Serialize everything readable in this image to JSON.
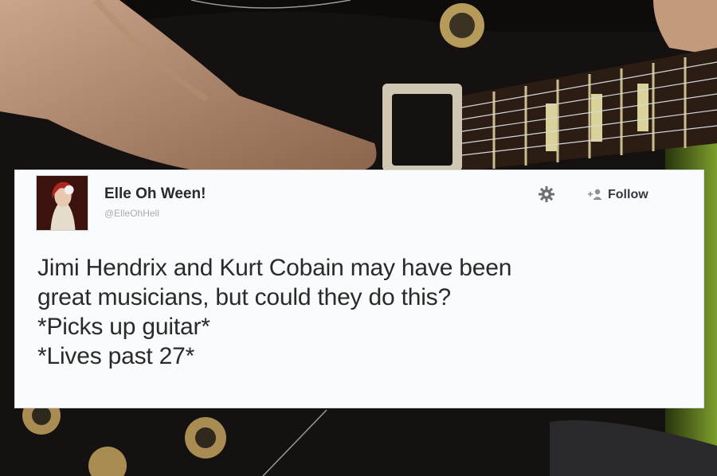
{
  "tweet": {
    "display_name": "Elle Oh Ween!",
    "handle": "@ElleOhHell",
    "follow_label": "Follow",
    "lines": [
      "Jimi Hendrix and Kurt Cobain may have been",
      "great musicians, but could they do this?",
      "*Picks up guitar*",
      "*Lives past 27*"
    ]
  },
  "icons": {
    "settings": "gear-icon",
    "follow": "add-user-icon"
  },
  "colors": {
    "card_background": "#f9fbfc",
    "text": "#2a2a2a",
    "handle_text": "#a8adb2",
    "photo_background": "#0d0b0a"
  }
}
